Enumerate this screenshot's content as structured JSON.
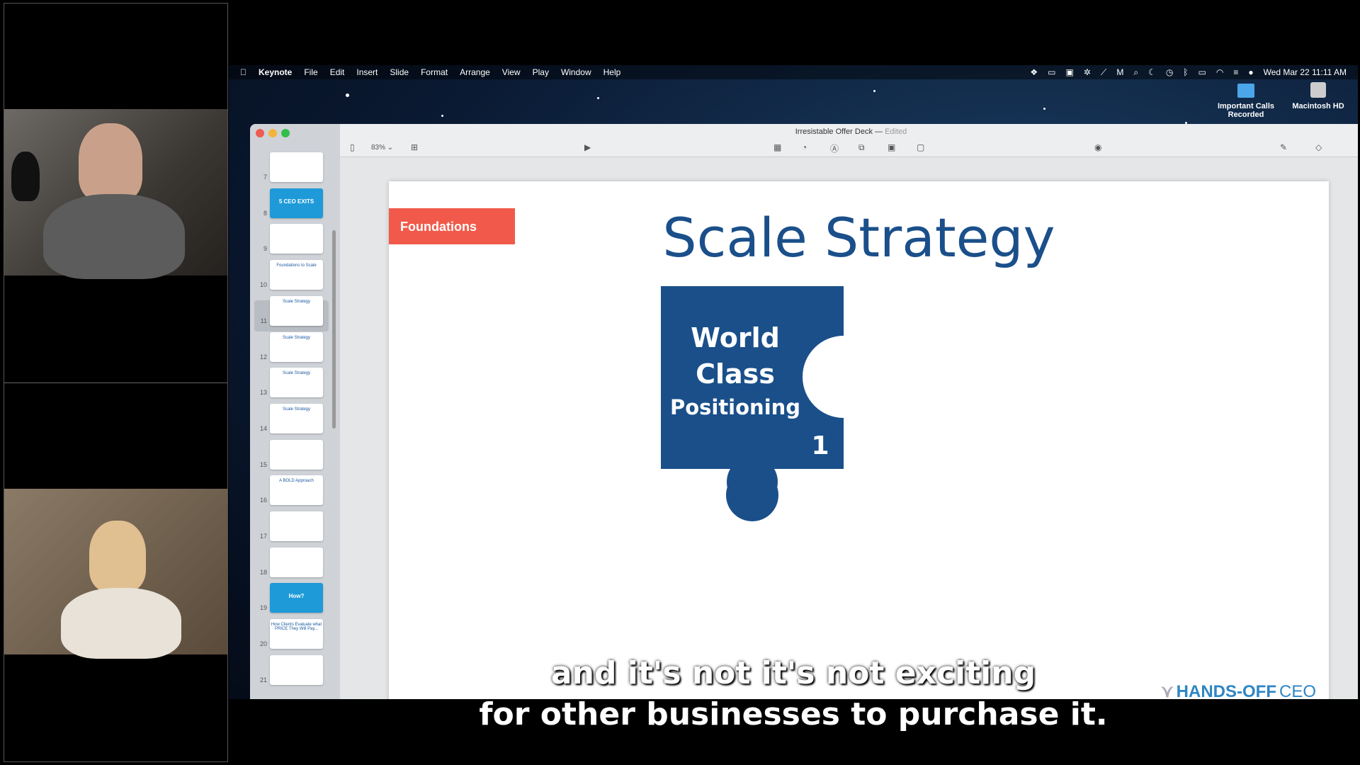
{
  "menubar": {
    "app": "Keynote",
    "items": [
      "File",
      "Edit",
      "Insert",
      "Slide",
      "Format",
      "Arrange",
      "View",
      "Play",
      "Window",
      "Help"
    ],
    "clock": "Wed Mar 22  11:11 AM"
  },
  "desktop": {
    "icons": [
      {
        "label": "Important Calls Recorded",
        "icon": "folder-icon"
      },
      {
        "label": "Macintosh HD",
        "icon": "hard-drive-icon"
      }
    ]
  },
  "window": {
    "title": "Irresistable Offer Deck",
    "status": "Edited",
    "zoom": "83%"
  },
  "slides": [
    {
      "n": "7",
      "text": ""
    },
    {
      "n": "8",
      "text": "5 CEO EXITS",
      "blue": true
    },
    {
      "n": "9",
      "text": ""
    },
    {
      "n": "10",
      "text": "Foundations to Scale"
    },
    {
      "n": "11",
      "text": "Scale Strategy",
      "selected": true
    },
    {
      "n": "12",
      "text": "Scale Strategy"
    },
    {
      "n": "13",
      "text": "Scale Strategy"
    },
    {
      "n": "14",
      "text": "Scale Strategy"
    },
    {
      "n": "15",
      "text": ""
    },
    {
      "n": "16",
      "text": "A BOLD Approach"
    },
    {
      "n": "17",
      "text": ""
    },
    {
      "n": "18",
      "text": ""
    },
    {
      "n": "19",
      "text": "How?",
      "blue": true
    },
    {
      "n": "20",
      "text": "How Clients Evaluate what PRICE They Will Pay..."
    },
    {
      "n": "21",
      "text": ""
    }
  ],
  "slide": {
    "tag": "Foundations",
    "title": "Scale Strategy",
    "puzzle": {
      "line1": "World",
      "line2": "Class",
      "line3": "Positioning",
      "number": "1"
    },
    "logo": {
      "bold": "HANDS-OFF",
      "light": "CEO"
    }
  },
  "colors": {
    "tag": "#f15a4a",
    "title": "#1a4f8a",
    "puzzle": "#1a4f8a",
    "accent": "#1e9ad8"
  },
  "subtitles": [
    "and it's not it's not exciting",
    "for other businesses to purchase it."
  ]
}
